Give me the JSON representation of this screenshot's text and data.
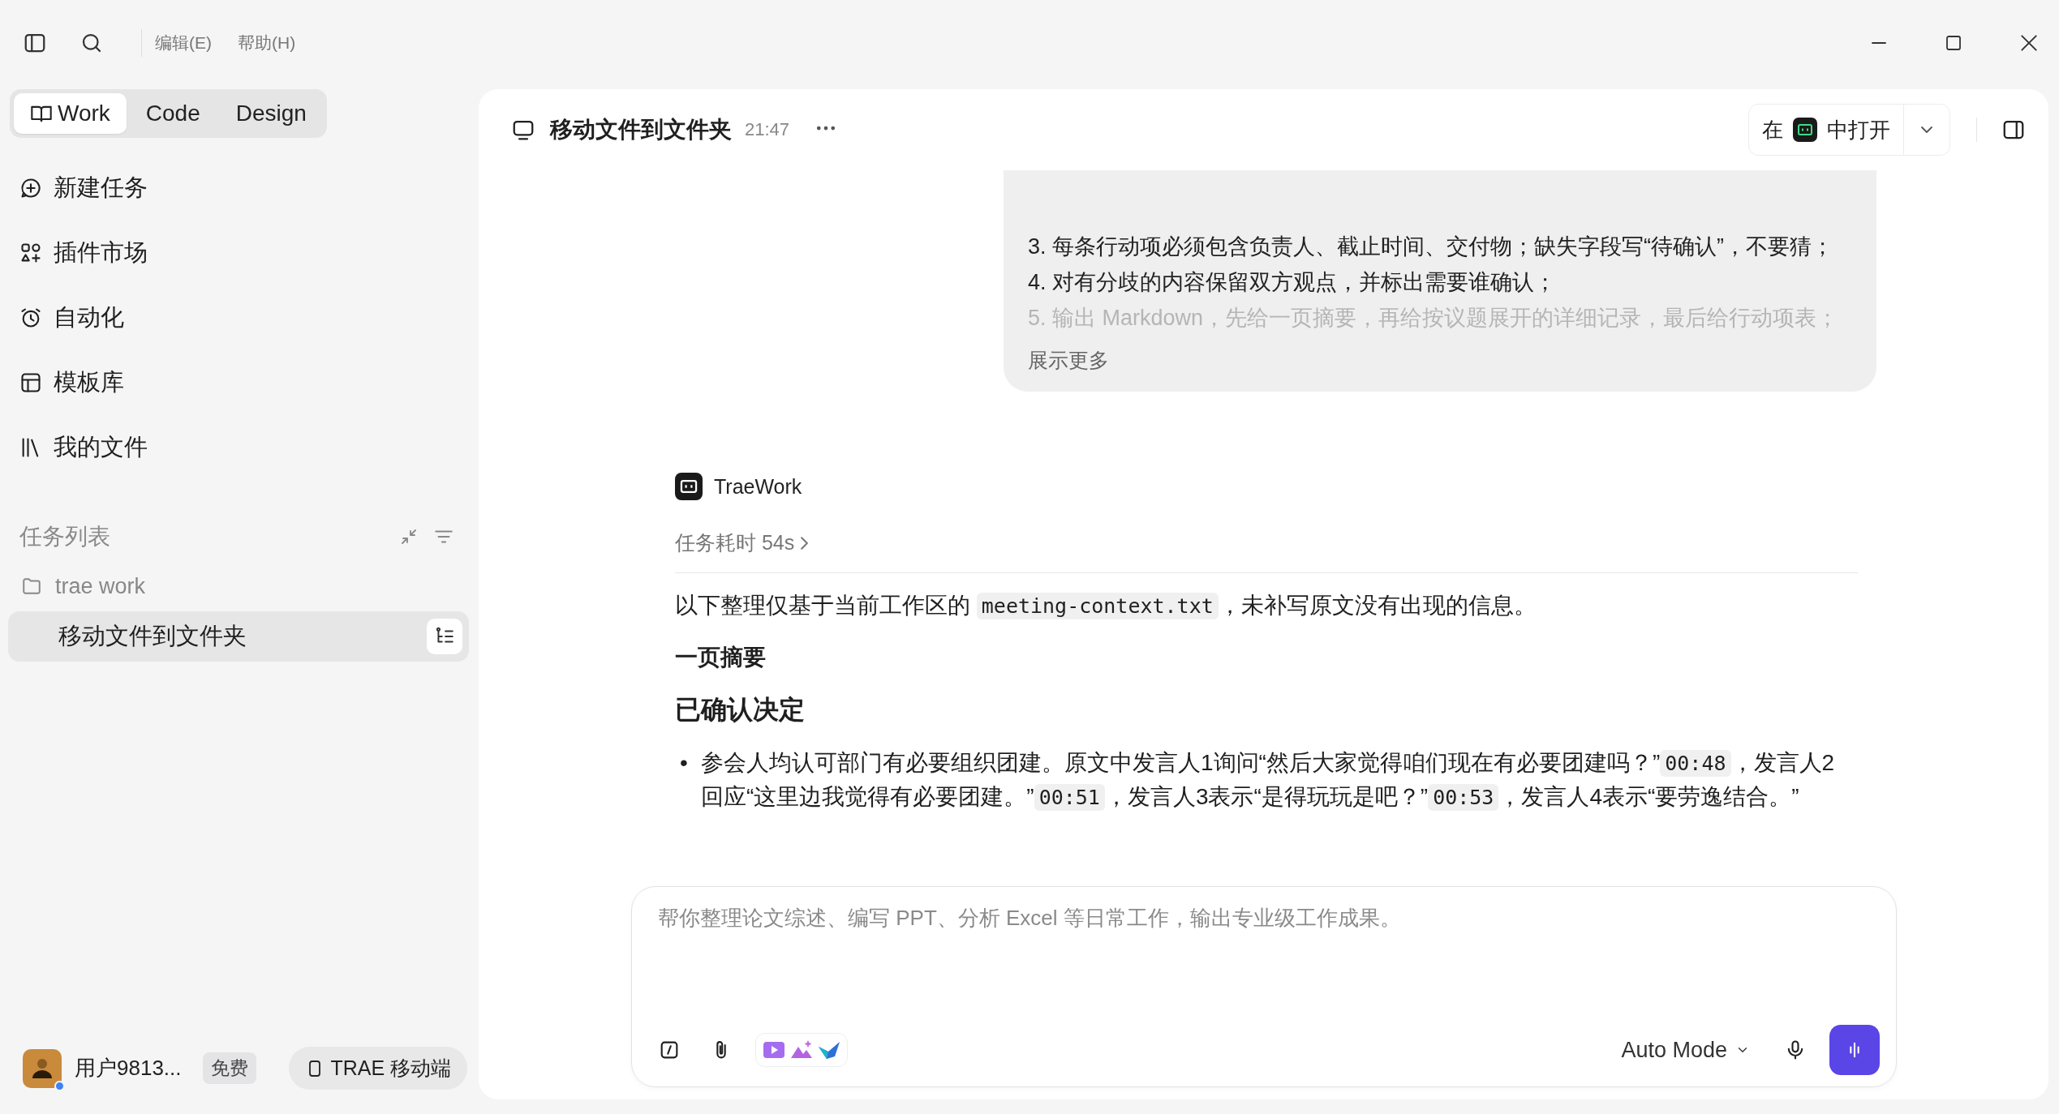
{
  "menu": [
    "编辑(E)",
    "帮助(H)"
  ],
  "mode_tabs": [
    {
      "label": "Work",
      "selected": true
    },
    {
      "label": "Code",
      "selected": false
    },
    {
      "label": "Design",
      "selected": false
    }
  ],
  "nav": [
    {
      "label": "新建任务"
    },
    {
      "label": "插件市场"
    },
    {
      "label": "自动化"
    },
    {
      "label": "模板库"
    },
    {
      "label": "我的文件"
    }
  ],
  "task_list": {
    "title": "任务列表",
    "folder": "trae work",
    "tasks": [
      {
        "label": "移动文件到文件夹",
        "selected": true
      }
    ]
  },
  "user": {
    "name": "用户9813...",
    "plan": "免费",
    "online": true
  },
  "mobile_button": "TRAE 移动端",
  "conversation": {
    "title": "移动文件到文件夹",
    "time": "21:47",
    "open_in": {
      "prefix": "在",
      "suffix": "中打开"
    },
    "user_message": {
      "lines": [
        {
          "text": "3. 每条行动项必须包含负责人、截止时间、交付物；缺失字段写“待确认”，不要猜；",
          "faded": false
        },
        {
          "text": "4. 对有分歧的内容保留双方观点，并标出需要谁确认；",
          "faded": false
        },
        {
          "text": "5. 输出 Markdown，先给一页摘要，再给按议题展开的详细记录，最后给行动项表；",
          "faded": true
        }
      ],
      "more": "展示更多"
    },
    "assistant": {
      "name": "TraeWork",
      "duration": "任务耗时 54s",
      "intro": [
        {
          "text": "以下整理仅基于当前工作区的 "
        },
        {
          "text": "meeting-context.txt",
          "code": true
        },
        {
          "text": "，未补写原文没有出现的信息。"
        }
      ],
      "summary_heading": "一页摘要",
      "decision_heading": "已确认决定",
      "bullets": [
        {
          "marker": "•",
          "segments": [
            {
              "text": "参会人均认可部门有必要组织团建。原文中发言人1询问“然后大家觉得咱们现在有必要团建吗？”"
            },
            {
              "text": "00:48",
              "code": true
            },
            {
              "text": "，发言人2回应“这里边我觉得有必要团建。”"
            },
            {
              "text": "00:51",
              "code": true
            },
            {
              "text": "，发言人3表示“是得玩玩是吧？”"
            },
            {
              "text": "00:53",
              "code": true
            },
            {
              "text": "，发言人4表示“要劳逸结合。”"
            }
          ]
        }
      ]
    }
  },
  "composer": {
    "placeholder": "帮你整理论文综述、编写 PPT、分析 Excel 等日常工作，输出专业级工作成果。",
    "mode": "Auto Mode"
  }
}
